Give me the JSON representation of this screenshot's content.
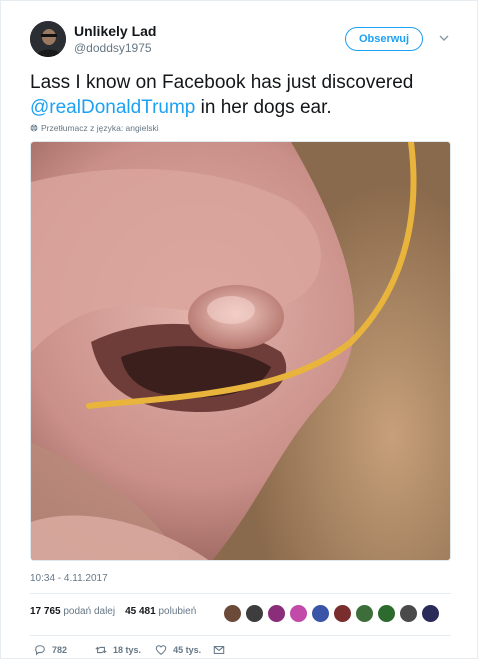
{
  "user": {
    "display_name": "Unlikely Lad",
    "handle": "@doddsy1975",
    "avatar_icon": "user-avatar"
  },
  "follow_label": "Obserwuj",
  "tweet": {
    "text_before": "Lass I know on Facebook has just discovered ",
    "mention": "@realDonaldTrump",
    "text_after": " in her dogs ear.",
    "translate_label": "Przetłumacz z języka: angielski",
    "timestamp": "10:34 - 4.11.2017"
  },
  "stats": {
    "retweets_count": "17 765",
    "retweets_label": "podań dalej",
    "likes_count": "45 481",
    "likes_label": "polubień"
  },
  "liker_avatars": [
    "#6b4a3a",
    "#3d3d3d",
    "#8a2d7a",
    "#c24aa8",
    "#3a55a8",
    "#7a2d2d",
    "#3d6e3a",
    "#2d6a2d",
    "#4a4a4a",
    "#2b2b5a"
  ],
  "actions": {
    "reply_count": "782",
    "retweet_count": "18 tys.",
    "like_count": "45 tys."
  },
  "colors": {
    "accent": "#1da1f2",
    "secondary_text": "#657786"
  }
}
